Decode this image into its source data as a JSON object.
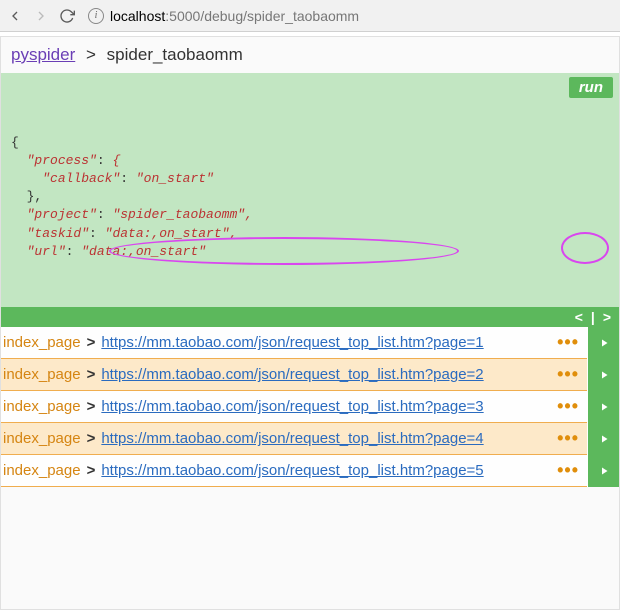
{
  "browser": {
    "url_host": "localhost",
    "url_port": ":5000",
    "url_path": "/debug/spider_taobaomm"
  },
  "breadcrumb": {
    "home": "pyspider",
    "sep": ">",
    "project": "spider_taobaomm"
  },
  "run_label": "run",
  "json_lines": [
    {
      "indent": 0,
      "type": "punct",
      "text": "{"
    },
    {
      "indent": 1,
      "type": "kv",
      "key": "\"process\"",
      "sep": ": ",
      "val": "{"
    },
    {
      "indent": 2,
      "type": "kv",
      "key": "\"callback\"",
      "sep": ": ",
      "val": "\"on_start\""
    },
    {
      "indent": 1,
      "type": "punct",
      "text": "},"
    },
    {
      "indent": 1,
      "type": "kv",
      "key": "\"project\"",
      "sep": ": ",
      "val": "\"spider_taobaomm\","
    },
    {
      "indent": 1,
      "type": "kv",
      "key": "\"taskid\"",
      "sep": ": ",
      "val": "\"data:,on_start\","
    },
    {
      "indent": 1,
      "type": "kv",
      "key": "\"url\"",
      "sep": ": ",
      "val": "\"data:,on_start\""
    }
  ],
  "pager": {
    "prev": "<",
    "div": "|",
    "next": ">"
  },
  "rows": [
    {
      "callback": "index_page",
      "sep": ">",
      "url": "https://mm.taobao.com/json/request_top_list.htm?page=1",
      "alt": false
    },
    {
      "callback": "index_page",
      "sep": ">",
      "url": "https://mm.taobao.com/json/request_top_list.htm?page=2",
      "alt": true
    },
    {
      "callback": "index_page",
      "sep": ">",
      "url": "https://mm.taobao.com/json/request_top_list.htm?page=3",
      "alt": false
    },
    {
      "callback": "index_page",
      "sep": ">",
      "url": "https://mm.taobao.com/json/request_top_list.htm?page=4",
      "alt": true
    },
    {
      "callback": "index_page",
      "sep": ">",
      "url": "https://mm.taobao.com/json/request_top_list.htm?page=5",
      "alt": false
    }
  ],
  "ellipsis": "•••"
}
